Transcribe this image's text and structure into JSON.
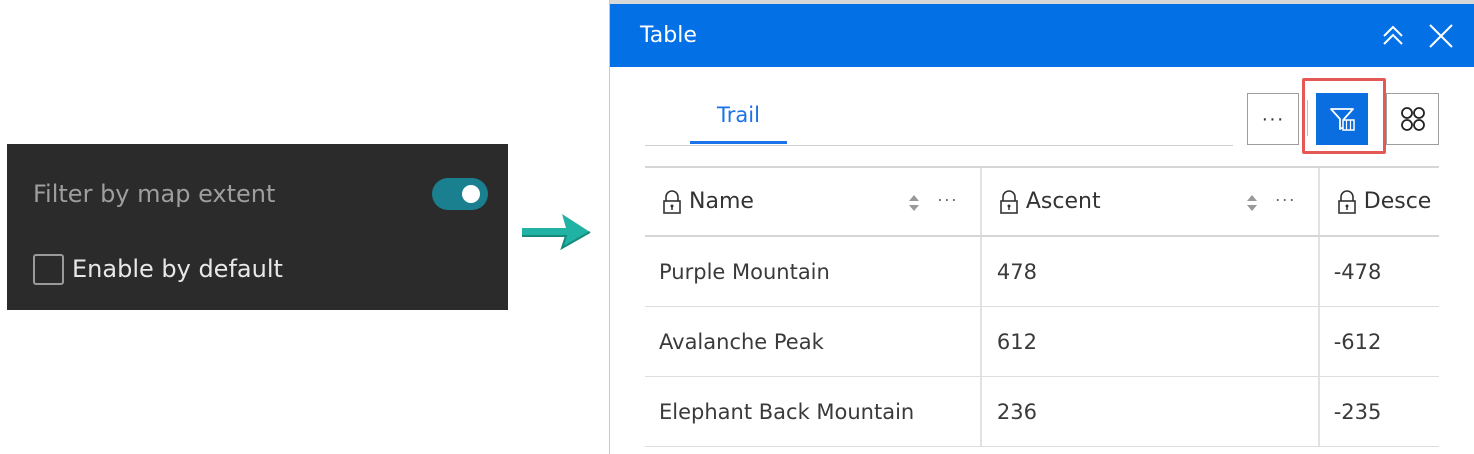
{
  "settings": {
    "filter_label": "Filter by map extent",
    "filter_enabled": true,
    "default_label": "Enable by default",
    "default_checked": false
  },
  "widget": {
    "title": "Table",
    "tabs": [
      {
        "label": "Trail",
        "active": true
      }
    ],
    "toolbar": {
      "more_glyph": "···",
      "filter_icon": "filter-map-icon",
      "columns_icon": "columns-grid-icon"
    },
    "columns": [
      {
        "label": "Name",
        "icon": "lock-icon"
      },
      {
        "label": "Ascent",
        "icon": "lock-icon"
      },
      {
        "label": "Desce",
        "icon": "lock-icon"
      }
    ],
    "column_menu_glyph": "···",
    "rows": [
      {
        "name": "Purple Mountain",
        "ascent": "478",
        "descent": "-478"
      },
      {
        "name": "Avalanche Peak",
        "ascent": "612",
        "descent": "-612"
      },
      {
        "name": "Elephant Back Mountain",
        "ascent": "236",
        "descent": "-235"
      }
    ]
  },
  "colors": {
    "header_bg": "#0470e6",
    "accent": "#1a73e8",
    "toggle_on": "#1a7f8e",
    "highlight": "#e45855",
    "arrow": "#20b2a2",
    "settings_bg": "#2b2b2b"
  }
}
